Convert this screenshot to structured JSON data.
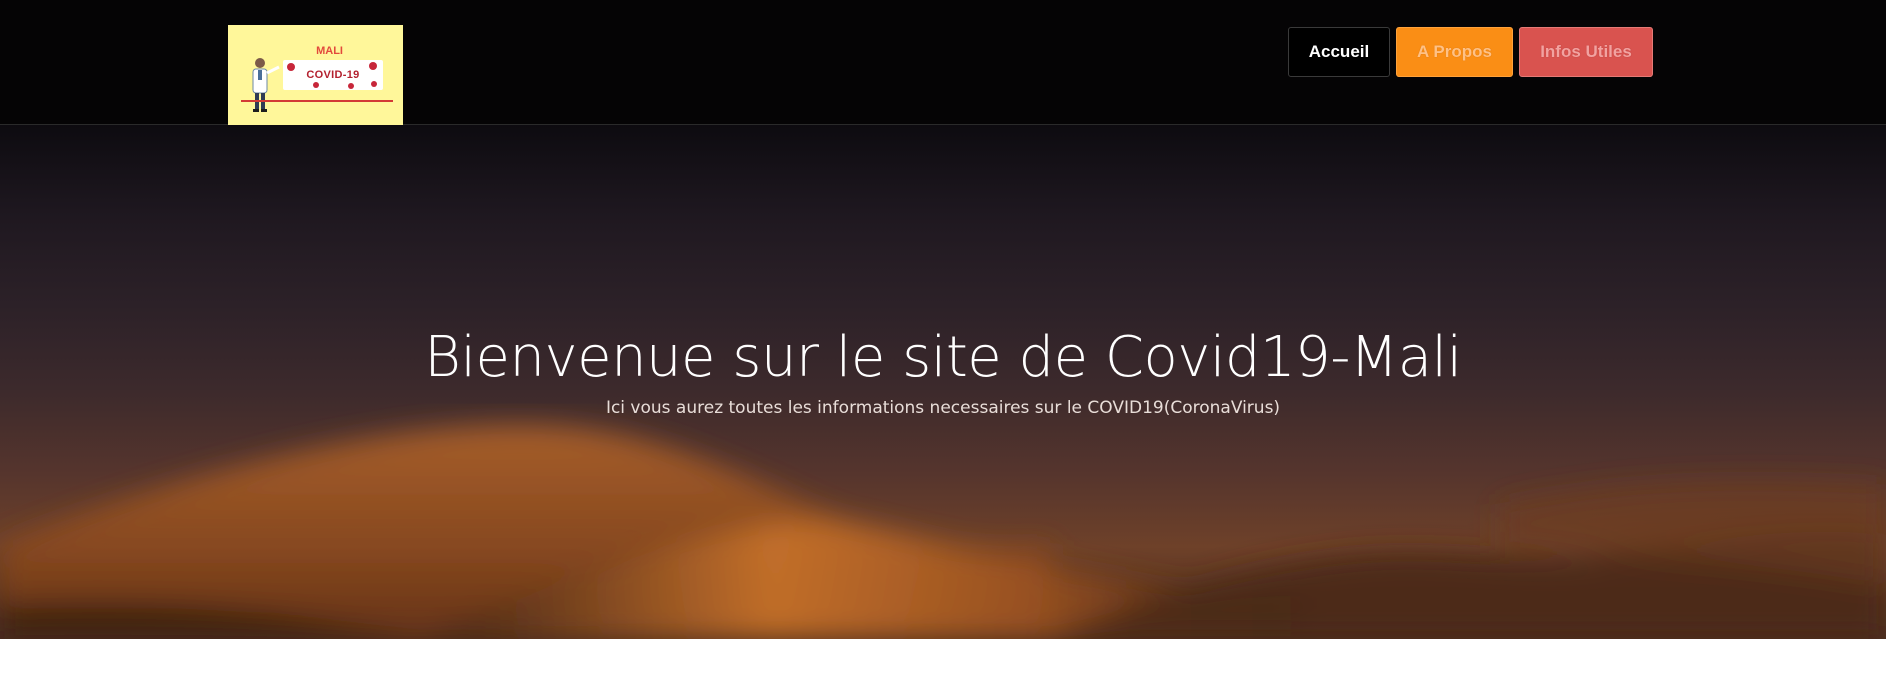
{
  "logo": {
    "title": "MALI",
    "card_text": "COVID-19"
  },
  "nav": {
    "items": [
      {
        "label": "Accueil"
      },
      {
        "label": "A Propos"
      },
      {
        "label": "Infos Utiles"
      }
    ]
  },
  "hero": {
    "title": "Bienvenue sur le site de Covid19-Mali",
    "subtitle": "Ici vous aurez toutes les informations necessaires sur le COVID19(CoronaVirus)"
  },
  "colors": {
    "navbar_bg": "#050405",
    "accueil_bg": "#000000",
    "apropos_bg": "#fa8e15",
    "infos_bg": "#d9534f",
    "logo_bg": "#fff79a"
  },
  "icons": {
    "logo_illustration": "doctor-icon",
    "virus": "virus-icon"
  }
}
